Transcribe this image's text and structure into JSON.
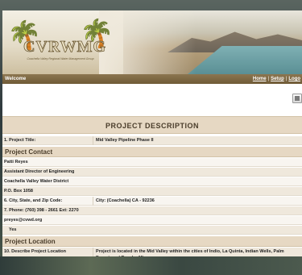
{
  "brand": {
    "logo_text": "CVRWMG",
    "logo_subtitle": "Coachella Valley Regional Water Management Group"
  },
  "navbar": {
    "welcome": "Welcome",
    "links": [
      "Home",
      "Setup",
      "Logo"
    ]
  },
  "page": {
    "title": "PROJECT DESCRIPTION"
  },
  "fields": {
    "project_title_label": "1. Project Title:",
    "project_title_value": "Mid Valley Pipeline Phase II",
    "contact_header": "Project Contact",
    "contact_name": "Patti Reyes",
    "contact_title": "Assistant Director of Engineering",
    "contact_org": "Coachella Valley Water District",
    "contact_po": "P.O. Box 1058",
    "city_label": "6. City, State, and Zip Code:",
    "city_value": "City: (Coachella)   CA  -   92236",
    "phone_label": "7. Phone: (760)   398  -   2661   Ext: 2270",
    "email": "preyes@cvwd.org",
    "yes": "Yes",
    "location_header": "Project Location",
    "location_label": "10. Describe Project Location",
    "location_value": "Project is located in the Mid Valley within the cities of Indio, La Quinta, Indian Wells, Palm Desert, and Rancho Mirage."
  },
  "icons": {
    "print": "print-icon",
    "palm": "palm-tree-icon"
  },
  "colors": {
    "nav_bg": "#7a6442",
    "header_bg": "#e6d8c3",
    "row_shade": "#efe8dc"
  }
}
